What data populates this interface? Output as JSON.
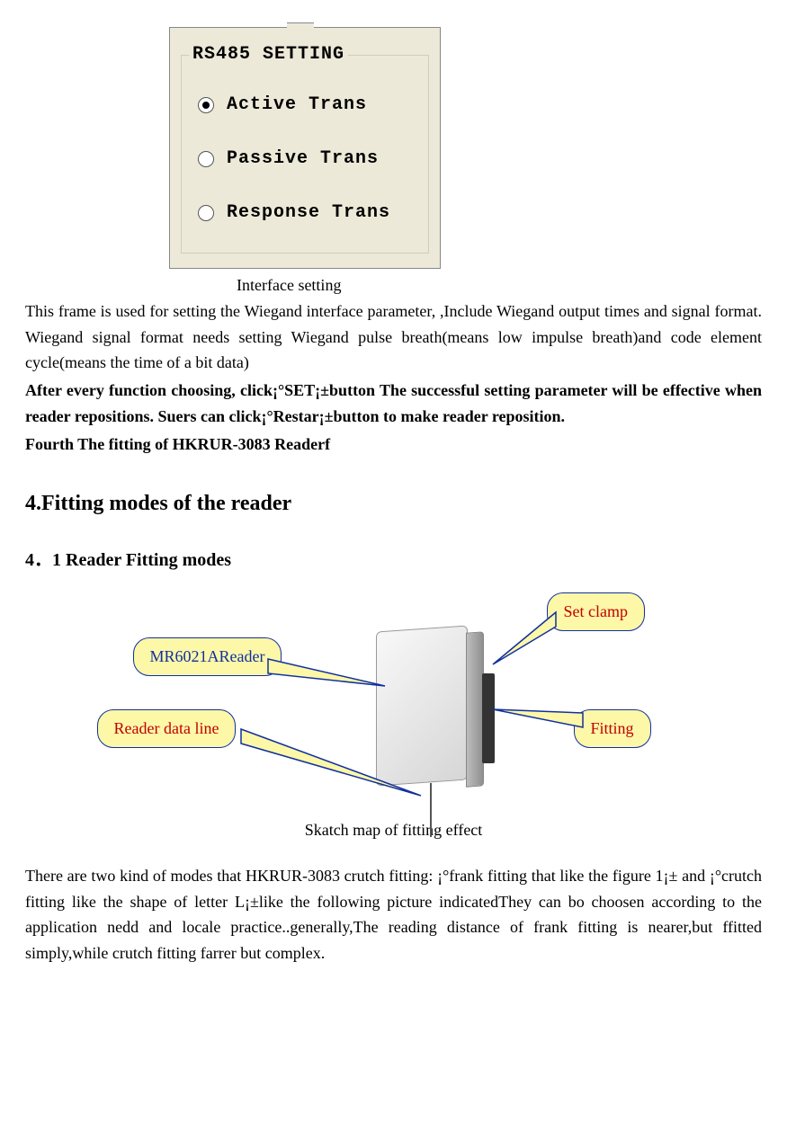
{
  "dialog": {
    "legend": "RS485 SETTING",
    "options": [
      {
        "label": "Active Trans",
        "selected": true
      },
      {
        "label": "Passive Trans",
        "selected": false
      },
      {
        "label": "Response Trans",
        "selected": false
      }
    ]
  },
  "interface_caption": "Interface setting",
  "paragraph1_a": "This frame is used for setting the Wiegand   interface parameter, ,Include Wiegand   output times and signal format. Wiegand signal format needs setting Wiegand pulse breath(means low impulse breath)and code element cycle(means the time of a bit data)",
  "paragraph1_b": "After every function choosing, click¡°SET¡±button The successful setting parameter will be effective when reader repositions. Suers can click¡°Restar¡±button to make reader reposition.",
  "paragraph1_c": "Fourth   The fitting of HKRUR-3083 Readerf",
  "section_title": "4.Fitting modes of the reader",
  "subsection_title": "4．1 Reader Fitting modes",
  "labels": {
    "reader": "MR6021AReader",
    "data_line": "Reader data line",
    "set_clamp": "Set clamp",
    "fitting": "Fitting"
  },
  "sketch_caption": "Skatch map of fitting effect",
  "paragraph2": "There are two kind of modes that HKRUR-3083 crutch fitting: ¡°frank fitting that like the figure 1¡± and ¡°crutch fitting like the shape of letter L¡±like the following picture indicatedThey can bo choosen according to the application nedd and locale practice..generally,The reading distance of frank fitting is nearer,but ffitted simply,while crutch fitting farrer but complex."
}
